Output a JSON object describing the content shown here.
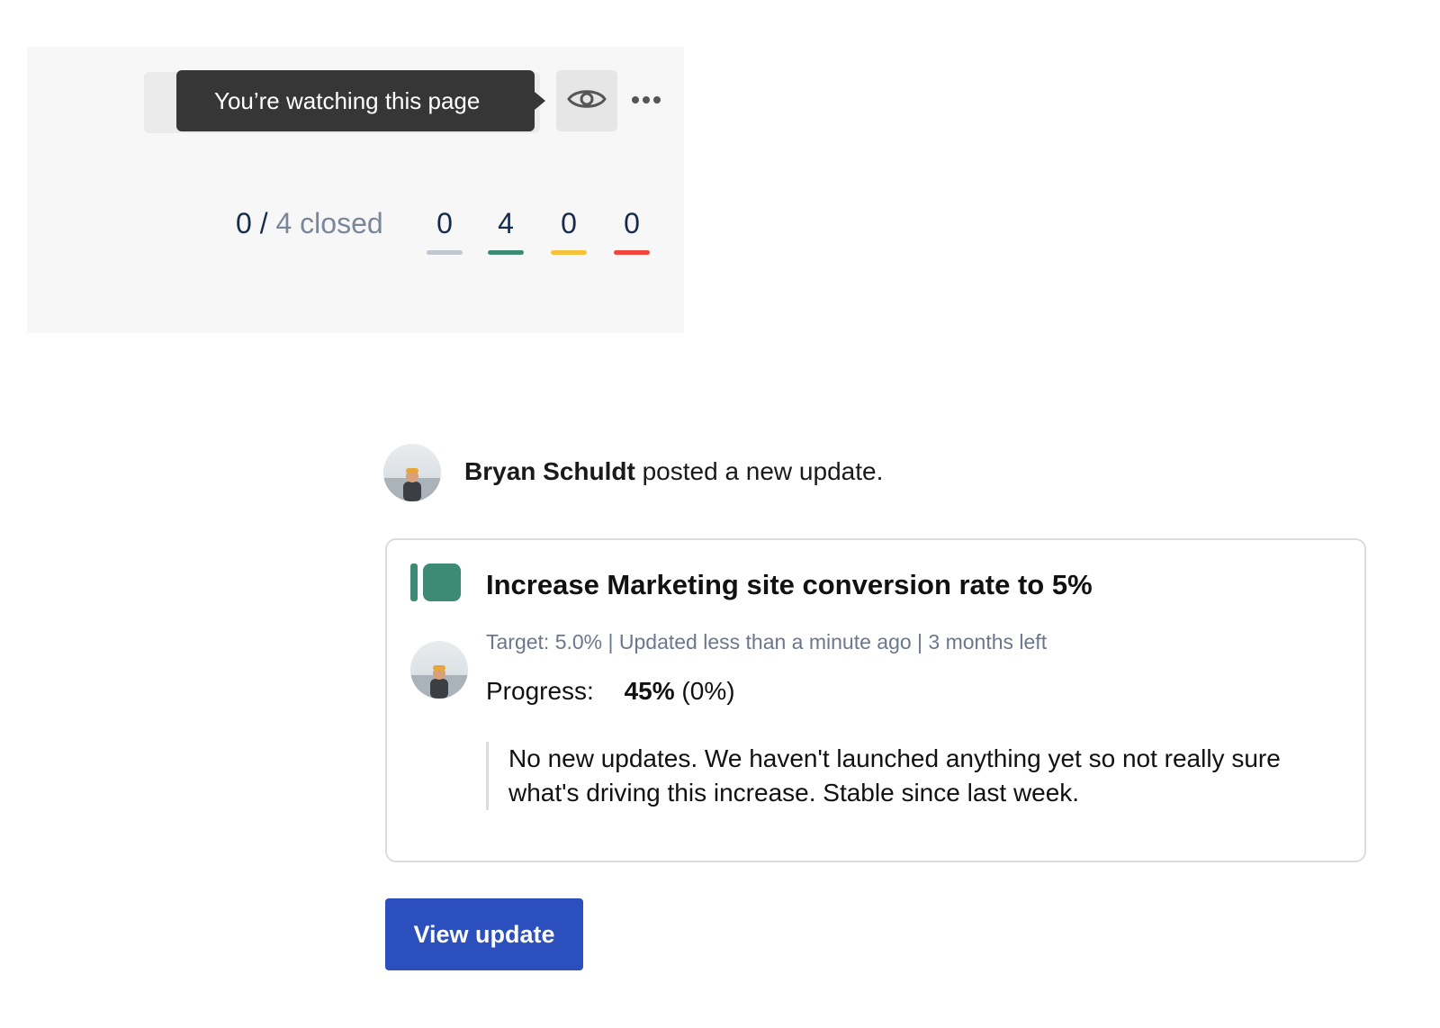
{
  "header": {
    "tooltip_text": "You’re watching this page",
    "watch_icon": "eye-icon",
    "more_icon": "more-horizontal-icon",
    "closed_summary": {
      "done": "0",
      "separator": "/",
      "total_text": "4 closed"
    },
    "counters": [
      {
        "value": "0",
        "color": "#c1c7d0"
      },
      {
        "value": "4",
        "color": "#3d8b74"
      },
      {
        "value": "0",
        "color": "#f5c23c"
      },
      {
        "value": "0",
        "color": "#f0463c"
      }
    ]
  },
  "update": {
    "author_name": "Bryan Schuldt",
    "action_text": " posted a new update.",
    "goal": {
      "icon": "goal-status-icon",
      "title": "Increase Marketing site conversion rate to 5%",
      "meta": "Target: 5.0% | Updated less than a minute ago | 3 months left",
      "progress_label": "Progress:",
      "progress_value": "45%",
      "progress_change": " (0%)",
      "comment": "No new updates. We haven't launched anything yet so not really sure what's driving this increase. Stable since last week."
    },
    "view_button_label": "View update"
  },
  "colors": {
    "accent": "#2c4fbe",
    "goal_green": "#3d8b74",
    "tooltip_bg": "#363636"
  }
}
